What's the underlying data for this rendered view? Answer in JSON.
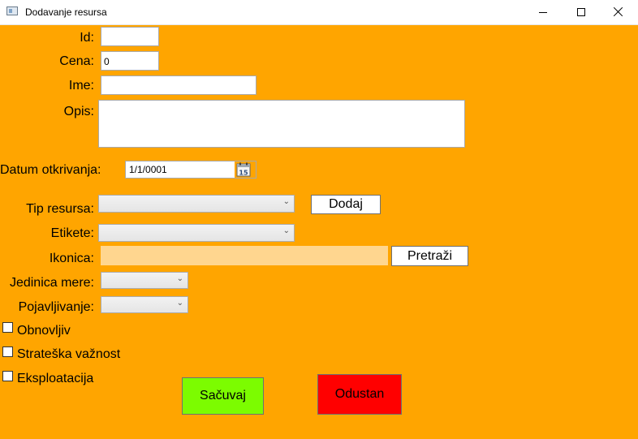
{
  "window": {
    "title": "Dodavanje resursa"
  },
  "fields": {
    "id_label": "Id:",
    "id_value": "",
    "cena_label": "Cena:",
    "cena_value": "0",
    "ime_label": "Ime:",
    "ime_value": "",
    "opis_label": "Opis:",
    "opis_value": "",
    "datum_label": "Datum otkrivanja:",
    "datum_value": "1/1/0001",
    "calendar_day": "15",
    "tip_label": "Tip resursa:",
    "etikete_label": "Etikete:",
    "ikonica_label": "Ikonica:",
    "ikonica_value": "",
    "jedinica_label": "Jedinica mere:",
    "pojavljivanje_label": "Pojavljivanje:"
  },
  "buttons": {
    "dodaj": "Dodaj",
    "pretrazi": "Pretraži",
    "sacuvaj": "Sačuvaj",
    "odustan": "Odustan"
  },
  "checkboxes": [
    {
      "label": "Obnovljiv",
      "checked": false
    },
    {
      "label": "Strateška važnost",
      "checked": false
    },
    {
      "label": "Eksploatacija",
      "checked": false
    }
  ],
  "colors": {
    "background": "#ffa500",
    "ikonica_field": "#ffd68f",
    "save": "#7cfc00",
    "cancel": "#ff0000"
  }
}
